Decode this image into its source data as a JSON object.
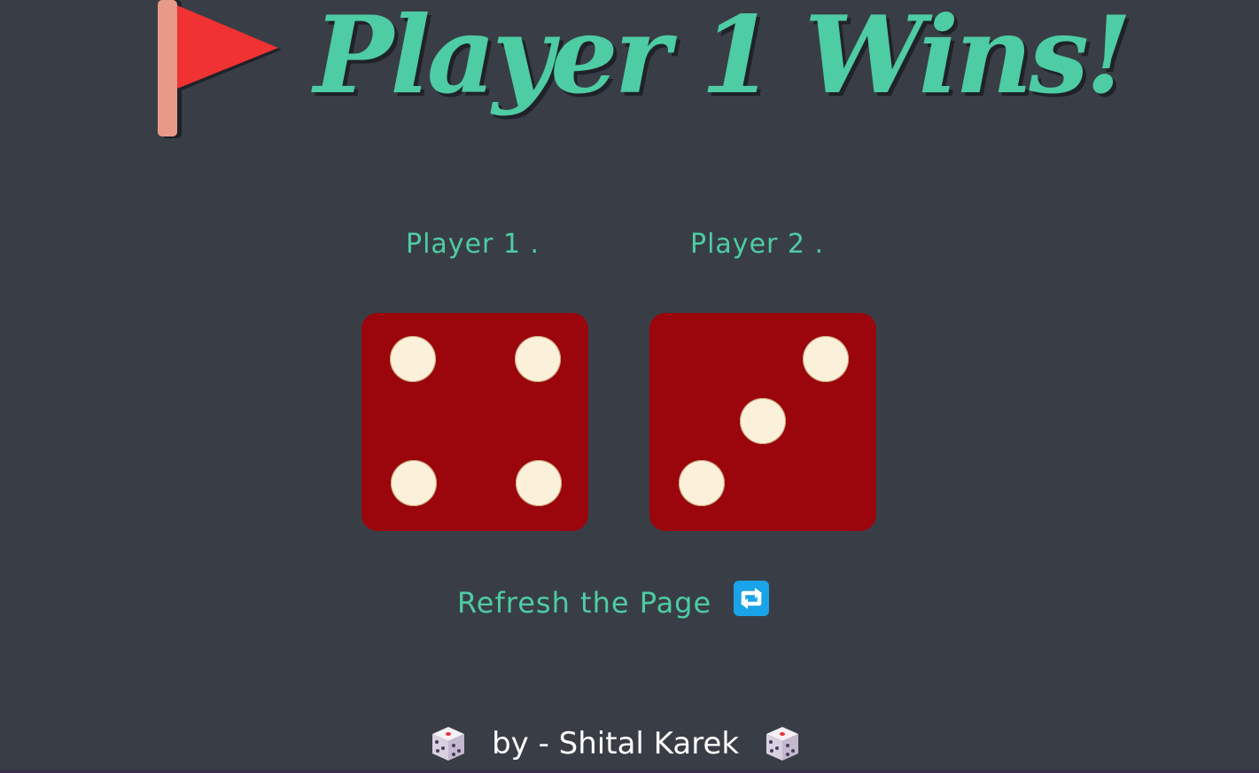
{
  "header": {
    "flag_icon": "red-flag-icon",
    "title": "Player 1 Wins!"
  },
  "players": [
    {
      "label": "Player 1 .",
      "die_value": 4
    },
    {
      "label": "Player 2 .",
      "die_value": 3
    }
  ],
  "refresh": {
    "label": "Refresh the Page",
    "icon": "refresh-arrows-icon"
  },
  "footer": {
    "text": "by - Shital Karek",
    "icon": "die-icon"
  },
  "colors": {
    "background": "#393e46",
    "accent": "#4ecca3",
    "die_face": "#9b050c",
    "pip": "#fbf0d9",
    "flag": "#f03232",
    "refresh_icon": "#1aa3e8"
  }
}
